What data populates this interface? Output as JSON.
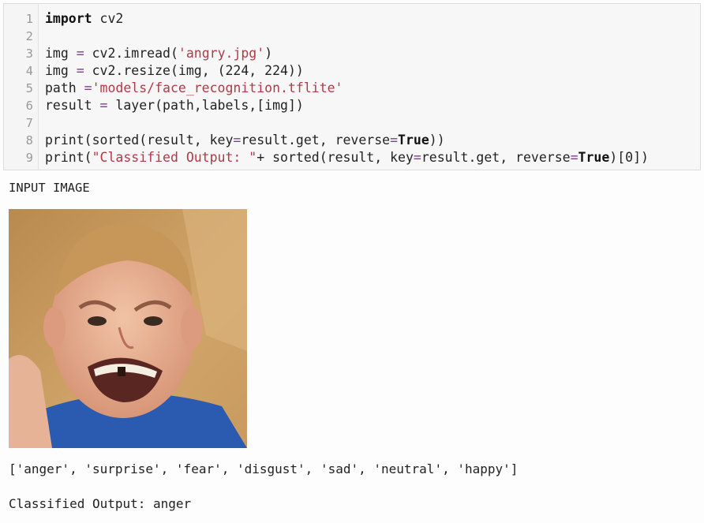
{
  "code_cell": {
    "line_numbers": [
      "1",
      "2",
      "3",
      "4",
      "5",
      "6",
      "7",
      "8",
      "9"
    ],
    "lines": [
      {
        "tokens": [
          {
            "t": "import",
            "c": "kw"
          },
          {
            "t": " cv2",
            "c": ""
          }
        ]
      },
      {
        "tokens": []
      },
      {
        "tokens": [
          {
            "t": "img ",
            "c": ""
          },
          {
            "t": "=",
            "c": "op"
          },
          {
            "t": " cv2.imread(",
            "c": ""
          },
          {
            "t": "'angry.jpg'",
            "c": "str"
          },
          {
            "t": ")",
            "c": ""
          }
        ]
      },
      {
        "tokens": [
          {
            "t": "img ",
            "c": ""
          },
          {
            "t": "=",
            "c": "op"
          },
          {
            "t": " cv2.resize(img, (224, 224))",
            "c": ""
          }
        ]
      },
      {
        "tokens": [
          {
            "t": "path ",
            "c": ""
          },
          {
            "t": "=",
            "c": "op"
          },
          {
            "t": "'models/face_recognition.tflite'",
            "c": "str"
          }
        ]
      },
      {
        "tokens": [
          {
            "t": "result ",
            "c": ""
          },
          {
            "t": "=",
            "c": "op"
          },
          {
            "t": " layer(path,labels,[img])",
            "c": ""
          }
        ]
      },
      {
        "tokens": []
      },
      {
        "tokens": [
          {
            "t": "print(sorted(result, key",
            "c": ""
          },
          {
            "t": "=",
            "c": "op"
          },
          {
            "t": "result.get, reverse",
            "c": ""
          },
          {
            "t": "=",
            "c": "op"
          },
          {
            "t": "True",
            "c": "kw"
          },
          {
            "t": "))",
            "c": ""
          }
        ]
      },
      {
        "tokens": [
          {
            "t": "print(",
            "c": ""
          },
          {
            "t": "\"Classified Output: \"",
            "c": "str"
          },
          {
            "t": "+ sorted(result, key",
            "c": ""
          },
          {
            "t": "=",
            "c": "op"
          },
          {
            "t": "result.get, reverse",
            "c": ""
          },
          {
            "t": "=",
            "c": "op"
          },
          {
            "t": "True",
            "c": "kw"
          },
          {
            "t": ")[0])",
            "c": ""
          }
        ]
      }
    ]
  },
  "output": {
    "label": "INPUT IMAGE",
    "sorted_list": "['anger', 'surprise', 'fear', 'disgust', 'sad', 'neutral', 'happy']",
    "classified": "Classified Output: anger"
  },
  "colors": {
    "background": "#fdfdfd",
    "cell_bg": "#f7f7f7",
    "string": "#b03a48",
    "operator": "#7a3e9d"
  }
}
